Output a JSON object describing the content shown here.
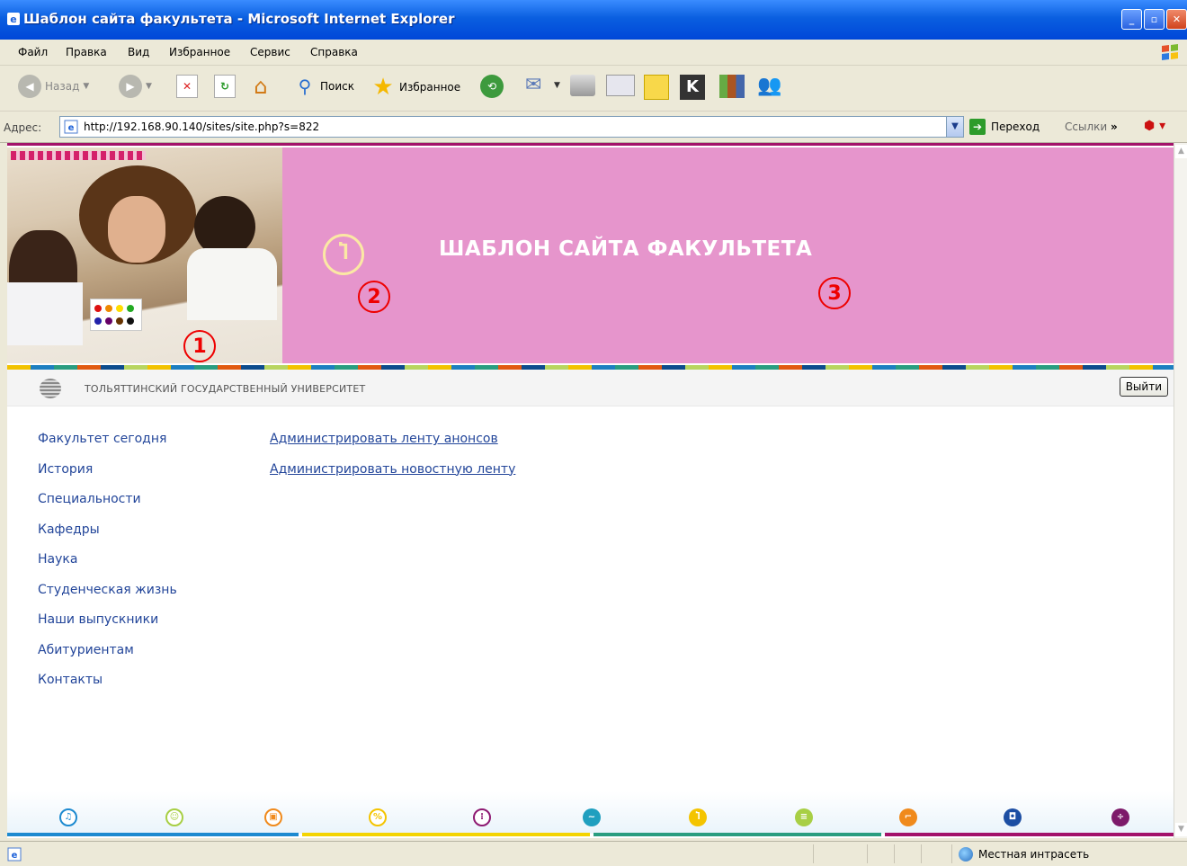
{
  "window": {
    "title": "Шаблон сайта факультета - Microsoft Internet Explorer",
    "minimize": "_",
    "maximize": "▫",
    "close": "✕"
  },
  "menu": [
    "Файл",
    "Правка",
    "Вид",
    "Избранное",
    "Сервис",
    "Справка"
  ],
  "toolbar": {
    "back_label": "Назад",
    "search_label": "Поиск",
    "favorites_label": "Избранное"
  },
  "address": {
    "label": "Адрес:",
    "url": "http://192.168.90.140/sites/site.php?s=822",
    "go_label": "Переход",
    "links_label": "Ссылки"
  },
  "page": {
    "site_title": "ШАБЛОН САЙТА ФАКУЛЬТЕТА",
    "annotations": [
      "1",
      "2",
      "3"
    ],
    "university": "ТОЛЬЯТТИНСКИЙ ГОСУДАРСТВЕННЫЙ УНИВЕРСИТЕТ",
    "logout_label": "Выйти",
    "nav_items": [
      "Факультет сегодня",
      "История",
      "Специальности",
      "Кафедры",
      "Наука",
      "Студенческая жизнь",
      "Наши выпускники",
      "Абитуриентам",
      "Контакты"
    ],
    "admin_links": [
      "Администрировать ленту анонсов",
      "Администрировать новостную ленту"
    ]
  },
  "footer_icons": [
    {
      "name": "music-icon",
      "color": "#1d8ad0",
      "style": "outline"
    },
    {
      "name": "smile-icon",
      "color": "#a8cf45",
      "style": "outline"
    },
    {
      "name": "square-icon",
      "color": "#f08a1c",
      "style": "outline"
    },
    {
      "name": "percent-icon",
      "color": "#f4c400",
      "style": "outline"
    },
    {
      "name": "dots-icon",
      "color": "#8e1a72",
      "style": "outline"
    },
    {
      "name": "wave-icon",
      "color": "#1f9fbf",
      "style": "solid"
    },
    {
      "name": "l-icon",
      "color": "#f4c400",
      "style": "solid"
    },
    {
      "name": "lines-icon",
      "color": "#a8cf45",
      "style": "solid"
    },
    {
      "name": "corners-icon",
      "color": "#f08a1c",
      "style": "solid"
    },
    {
      "name": "box-icon",
      "color": "#1c4ea3",
      "style": "solid"
    },
    {
      "name": "divide-icon",
      "color": "#7d1a6a",
      "style": "solid"
    }
  ],
  "footer_strip_colors": [
    "#1d8ad0",
    "#f4d400",
    "#2a9d80",
    "#a3126a"
  ],
  "status": {
    "zone_label": "Местная интрасеть"
  },
  "colors": {
    "banner": "#E695CC",
    "link": "#23469a",
    "annotation": "#e00000"
  }
}
